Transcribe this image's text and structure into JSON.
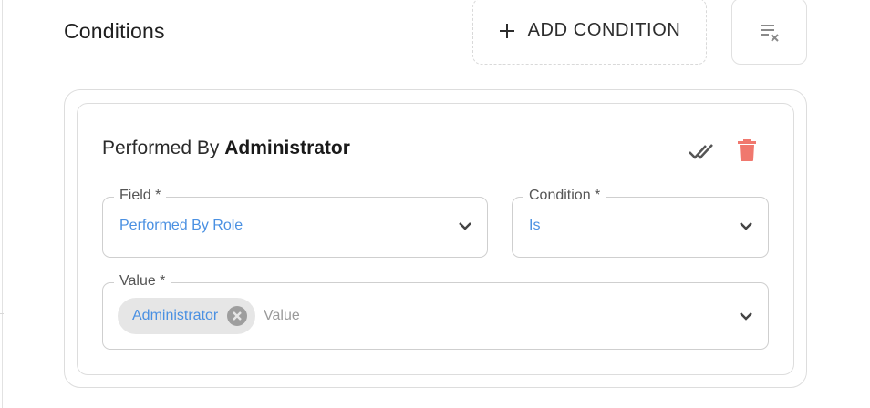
{
  "conditions": {
    "title": "Conditions",
    "add_button_label": "ADD CONDITION",
    "clear_icon": "clear-all-icon"
  },
  "condition_card": {
    "heading_prefix": "Performed By",
    "heading_value": "Administrator",
    "actions": [
      "double-check-icon",
      "trash-icon"
    ],
    "colors": {
      "trash": "#f0786e",
      "accent_text": "#4a90e2"
    },
    "fields": {
      "field": {
        "label": "Field *",
        "value": "Performed By Role"
      },
      "condition": {
        "label": "Condition *",
        "value": "Is"
      },
      "value": {
        "label": "Value *",
        "chips": [
          "Administrator"
        ],
        "placeholder": "Value"
      }
    }
  }
}
